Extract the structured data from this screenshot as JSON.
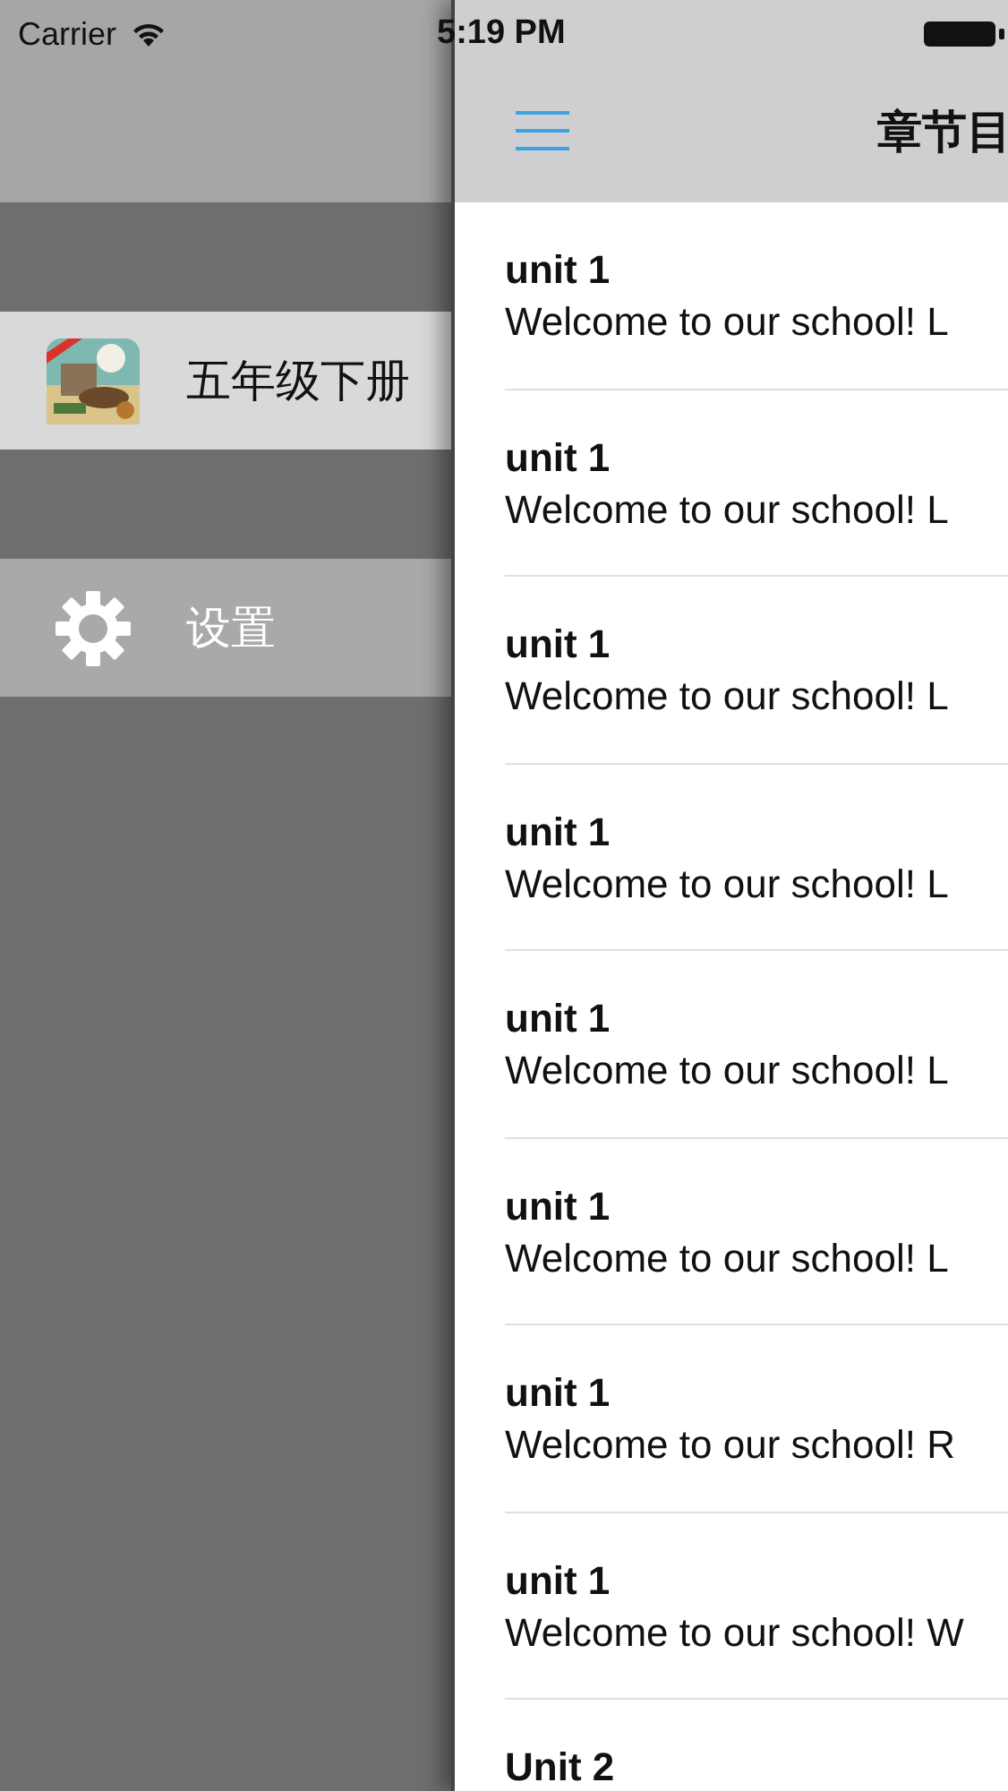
{
  "status_bar": {
    "carrier": "Carrier",
    "time": "5:19 PM"
  },
  "drawer": {
    "items": [
      {
        "kind": "book",
        "label": "五年级下册",
        "selected": true
      },
      {
        "kind": "settings",
        "label": "设置",
        "selected": false
      }
    ]
  },
  "nav_bar": {
    "title": "章节目"
  },
  "chapters": [
    {
      "title": "unit 1",
      "subtitle": "Welcome to our school! L"
    },
    {
      "title": "unit 1",
      "subtitle": "Welcome to our school! L"
    },
    {
      "title": "unit 1",
      "subtitle": "Welcome to our school! L"
    },
    {
      "title": "unit 1",
      "subtitle": "Welcome to our school! L"
    },
    {
      "title": "unit 1",
      "subtitle": "Welcome to our school! L"
    },
    {
      "title": "unit 1",
      "subtitle": "Welcome to our school! L"
    },
    {
      "title": "unit 1",
      "subtitle": "Welcome to our school! R"
    },
    {
      "title": "unit 1",
      "subtitle": "Welcome to our school! W"
    },
    {
      "title": "Unit 2"
    }
  ]
}
